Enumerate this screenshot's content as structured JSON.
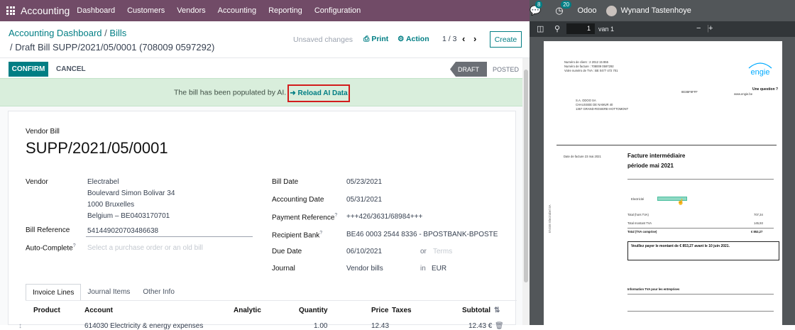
{
  "navbar": {
    "app_name": "Accounting",
    "menus": [
      "Dashboard",
      "Customers",
      "Vendors",
      "Accounting",
      "Reporting",
      "Configuration"
    ],
    "messages_count": "8",
    "activities_count": "20",
    "company": "Odoo",
    "user": "Wynand Tastenhoye"
  },
  "breadcrumb": {
    "parent": "Accounting Dashboard",
    "sep": "/",
    "current": "Bills",
    "record": "/ Draft Bill SUPP/2021/05/0001 (708009 0597292)"
  },
  "control": {
    "unsaved": "Unsaved changes",
    "print": "Print",
    "action": "Action",
    "pager": "1 / 3",
    "create": "Create"
  },
  "statusbar": {
    "confirm": "CONFIRM",
    "cancel": "CANCEL",
    "stages": [
      "DRAFT",
      "POSTED"
    ]
  },
  "alert": {
    "message": "The bill has been populated by AI.",
    "help": "?",
    "reload": "Reload AI Data"
  },
  "form": {
    "type_label": "Vendor Bill",
    "name": "SUPP/2021/05/0001",
    "vendor_label": "Vendor",
    "vendor_name": "Electrabel",
    "vendor_addr1": "Boulevard Simon Bolivar 34",
    "vendor_addr2": "1000 Bruxelles",
    "vendor_addr3": "Belgium – BE0403170701",
    "bill_ref_label": "Bill Reference",
    "bill_ref_value": "541449020703486638",
    "autocomplete_label": "Auto-Complete",
    "autocomplete_placeholder": "Select a purchase order or an old bill",
    "bill_date_label": "Bill Date",
    "bill_date_value": "05/23/2021",
    "acc_date_label": "Accounting Date",
    "acc_date_value": "05/31/2021",
    "payref_label": "Payment Reference",
    "payref_value": "+++426/3631/68984+++",
    "recipient_label": "Recipient Bank",
    "recipient_value": "BE46 0003 2544 8336 - BPOSTBANK-BPOSTE",
    "due_label": "Due Date",
    "due_value": "06/10/2021",
    "due_or": "or",
    "terms_placeholder": "Terms",
    "journal_label": "Journal",
    "journal_value": "Vendor bills",
    "journal_in": "in",
    "currency": "EUR"
  },
  "tabs": [
    "Invoice Lines",
    "Journal Items",
    "Other Info"
  ],
  "lines": {
    "headers": [
      "Product",
      "Account",
      "Analytic",
      "Quantity",
      "Price",
      "Taxes",
      "Subtotal"
    ],
    "rows": [
      {
        "account": "614030 Electricity & energy expenses",
        "quantity": "1.00",
        "price": "12.43",
        "subtotal": "12.43 €"
      }
    ]
  },
  "pdf": {
    "page": "1",
    "of": "van 1",
    "logo": "ENGIE",
    "client": "Numéro de client : 2 2012 15 855",
    "invoice_no": "Numéro de facture : 708009 0597292",
    "vat_no": "Votre numéro de TVA : BE 0477 472 701",
    "recipient1": "S.A. ODOO SA",
    "recipient2": "CHAUSSEE DE NAMUR 40",
    "recipient3": "1367 GRAND-ROSIERE-HOTTOMONT",
    "question": "Une question ?",
    "website": "www.engie.be",
    "date_facture": "Date de facture 23 mai 2021",
    "title1": "Facture intermédiaire",
    "title2": "période mai 2021",
    "electricite": "Electricité",
    "total_htva_label": "Total (hors TVA)",
    "total_htva": "707,34",
    "total_tva_label": "Total montant TVA",
    "total_tva": "145,93",
    "total_ttc_label": "Total (TVA comprise)",
    "total_ttc": "€ 853,27",
    "pay_msg": "Veuillez payer le montant de € 853,27 avant le 10 juin 2021.",
    "tva_info": "Information TVA pour les entreprises",
    "side_text": "ENGIE Electrabel SA"
  }
}
